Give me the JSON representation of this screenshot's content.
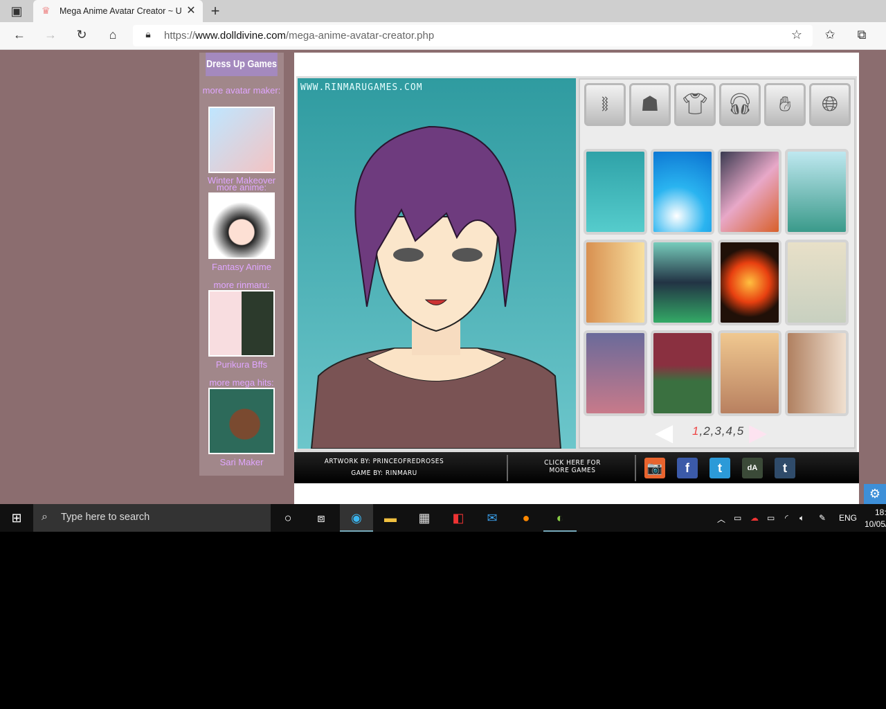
{
  "browser": {
    "tab_title": "Mega Anime Avatar Creator ~ U",
    "url_prefix": "https://",
    "url_domain": "www.dolldivine.com",
    "url_path": "/mega-anime-avatar-creator.php"
  },
  "sidebar": {
    "header": "Dress Up Games",
    "items": [
      {
        "caption_above": "more avatar maker:",
        "title": "Winter Makeover",
        "colors": [
          "#bfe6ff",
          "#f3c3c3"
        ]
      },
      {
        "caption_above": "more anime:",
        "title": "Fantasy Anime",
        "colors": [
          "#ffffff",
          "#222222"
        ]
      },
      {
        "caption_above": "more rinmaru:",
        "title": "Purikura Bffs",
        "colors": [
          "#f8dde0",
          "#2c3a2c"
        ]
      },
      {
        "caption_above": "more mega hits:",
        "title": "Sari Maker",
        "colors": [
          "#2d6a5a",
          "#7a4a30"
        ]
      }
    ]
  },
  "game": {
    "watermark": "WWW.RINMARUGAMES.COM",
    "categories": [
      "dna-icon",
      "hair-icon",
      "shirt-icon",
      "headset-icon",
      "hand-icon",
      "globe-icon"
    ],
    "backgrounds": [
      "teal",
      "sky-light",
      "festival",
      "mountains",
      "sunset-window",
      "machine",
      "fireworks",
      "train",
      "street",
      "library",
      "desert",
      "hallway"
    ],
    "pager": {
      "current": "1",
      "rest": ",2,3,4,5"
    },
    "footer": {
      "artwork": "ARTWORK BY: PRINCEOFREDROSES",
      "game_by": "GAME BY: RINMARU",
      "more_line1": "CLICK HERE FOR",
      "more_line2": "MORE GAMES"
    },
    "social": [
      {
        "name": "camera",
        "label": "📷",
        "color": "#e9642e"
      },
      {
        "name": "facebook",
        "label": "f",
        "color": "#3b5aa8"
      },
      {
        "name": "twitter",
        "label": "t",
        "color": "#2c9ad8"
      },
      {
        "name": "deviantart",
        "label": "dA",
        "color": "#3b4a38"
      },
      {
        "name": "tumblr",
        "label": "t",
        "color": "#2f4b6a"
      }
    ]
  },
  "taskbar": {
    "search_placeholder": "Type here to search",
    "lang": "ENG",
    "time": "18:",
    "date": "10/05/"
  }
}
